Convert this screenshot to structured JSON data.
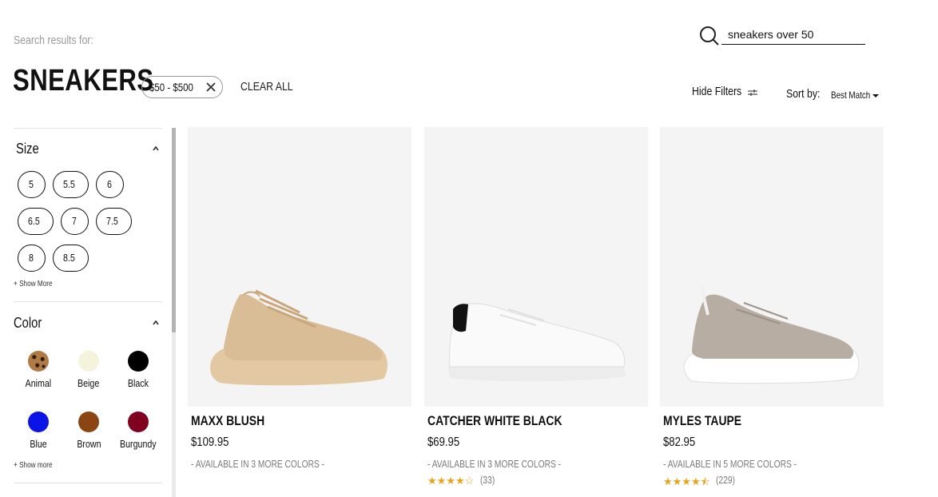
{
  "search": {
    "label": "Search results for:",
    "query": "sneakers over 50"
  },
  "title": "SNEAKERS",
  "active_filter": {
    "label": "$50 - $500"
  },
  "clear_all": "CLEAR ALL",
  "toolbar": {
    "hide_filters": "Hide Filters",
    "sort_label": "Sort by:",
    "sort_value": "Best Match"
  },
  "filters": {
    "size": {
      "title": "Size",
      "options": [
        "5",
        "5.5",
        "6",
        "6.5",
        "7",
        "7.5",
        "8",
        "8.5"
      ],
      "show_more": "+ Show More"
    },
    "color": {
      "title": "Color",
      "options": [
        {
          "label": "Animal",
          "color": "#8a6238"
        },
        {
          "label": "Beige",
          "color": "#f6f3dc"
        },
        {
          "label": "Black",
          "color": "#000000"
        },
        {
          "label": "Blue",
          "color": "#0a14e6"
        },
        {
          "label": "Brown",
          "color": "#8b4513"
        },
        {
          "label": "Burgundy",
          "color": "#800020"
        }
      ],
      "show_more": "+ Show more"
    }
  },
  "products": [
    {
      "name": "MAXX BLUSH",
      "price": "$109.95",
      "colors": "- AVAILABLE IN 3 MORE COLORS -",
      "rating": "",
      "reviews": ""
    },
    {
      "name": "CATCHER WHITE BLACK",
      "price": "$69.95",
      "colors": "- AVAILABLE IN 3 MORE COLORS -",
      "rating": 3.5,
      "reviews": "(33)"
    },
    {
      "name": "MYLES TAUPE",
      "price": "$82.95",
      "colors": "- AVAILABLE IN 5 MORE COLORS -",
      "rating": 4.5,
      "reviews": "(229)"
    }
  ]
}
